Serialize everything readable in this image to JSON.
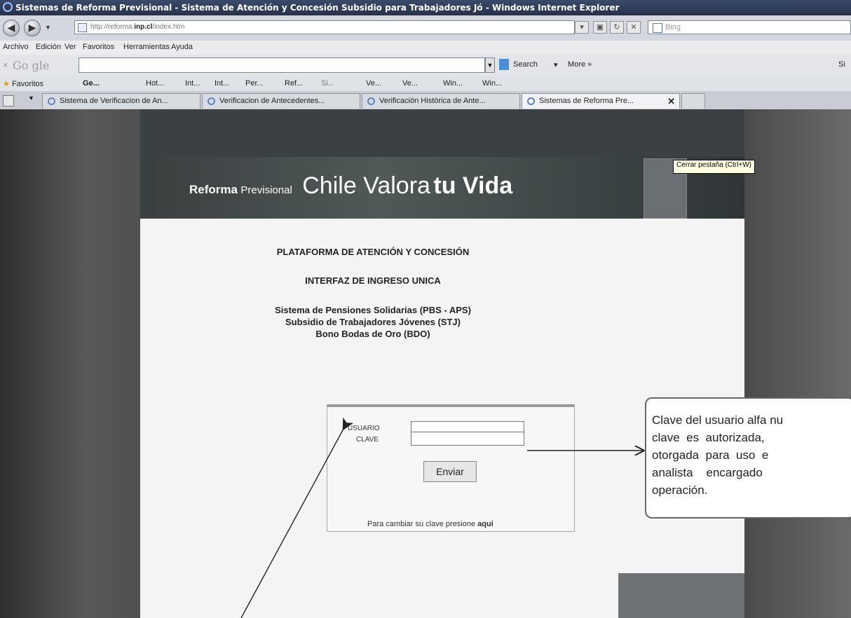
{
  "window": {
    "title": "Sistemas de Reforma Previsional - Sistema de Atención y Concesión Subsidio para Trabajadores Jó - Windows Internet Explorer"
  },
  "address": {
    "url_prefix": "http://reforma.",
    "url_domain": "inp.cl",
    "url_suffix": "/index.htm",
    "search_placeholder": "Bing"
  },
  "menu": [
    "Archivo",
    "Edición",
    "Ver",
    "Favoritos",
    "Herramientas",
    "Ayuda"
  ],
  "google": {
    "logo": "Go gle",
    "search_label": "Search",
    "more_label": "More »",
    "right_label": "Si"
  },
  "favorites": {
    "label": "Favoritos",
    "items": [
      "Ge...",
      "Hot...",
      "Int...",
      "Int...",
      "Per...",
      "Ref...",
      "Si...",
      "Ve...",
      "Ve...",
      "Win...",
      "Win..."
    ]
  },
  "tabs": [
    {
      "label": "Sistema de Verificacion de An...",
      "active": false
    },
    {
      "label": "Verificacion de Antecedentes...",
      "active": false
    },
    {
      "label": "Verificación Histórica de Ante...",
      "active": false
    },
    {
      "label": "Sistemas de Reforma Pre...",
      "active": true
    }
  ],
  "tooltip": "Cerrar pestaña (Ctrl+W)",
  "banner": {
    "part1": "Reforma",
    "part2": "Previsional",
    "part3": "Chile Valora",
    "part4": "tu Vida"
  },
  "content": {
    "title1": "PLATAFORMA DE ATENCIÓN Y CONCESIÓN",
    "title2": "INTERFAZ DE INGRESO UNICA",
    "line1": "Sistema de Pensiones Solidarias (PBS - APS)",
    "line2": "Subsidio de Trabajadores Jóvenes (STJ)",
    "line3": "Bono Bodas de Oro (BDO)"
  },
  "login": {
    "user_label": "USUARIO",
    "user_value": "",
    "pass_label": "CLAVE",
    "pass_value": "",
    "submit_label": "Enviar",
    "change_text": "Para cambiar su clave presione",
    "change_link": "aqui"
  },
  "callout": {
    "text": "Clave del usuario alfa nu\nclave  es  autorizada,  \notorgada  para  uso  e\nanalista    encargado  \noperación."
  }
}
